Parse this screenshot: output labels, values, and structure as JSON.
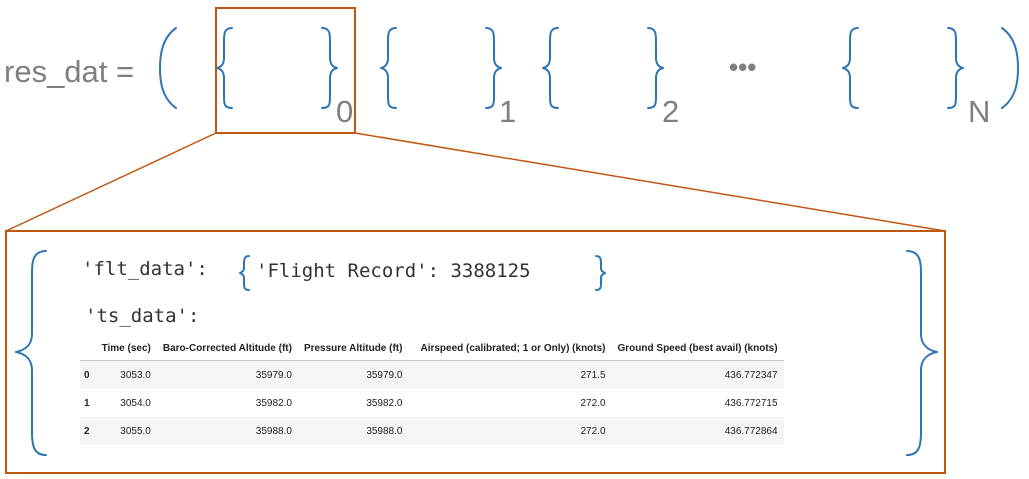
{
  "top": {
    "lhs": "res_dat =",
    "subscripts": [
      "0",
      "1",
      "2",
      "N"
    ],
    "ellipsis": "•••"
  },
  "detail": {
    "flt_key": "'flt_data':",
    "flt_inner": "'Flight Record': 3388125",
    "ts_key": "'ts_data':",
    "table": {
      "headers": [
        "",
        "Time (sec)",
        "Baro-Corrected Altitude (ft)",
        "Pressure Altitude (ft)",
        "Airspeed (calibrated; 1 or Only) (knots)",
        "Ground Speed (best avail) (knots)"
      ],
      "rows": [
        [
          "0",
          "3053.0",
          "35979.0",
          "35979.0",
          "271.5",
          "436.772347"
        ],
        [
          "1",
          "3054.0",
          "35982.0",
          "35982.0",
          "272.0",
          "436.772715"
        ],
        [
          "2",
          "3055.0",
          "35988.0",
          "35988.0",
          "272.0",
          "436.772864"
        ]
      ]
    }
  },
  "colors": {
    "brace": "#2e75b6",
    "highlight": "#c0560f",
    "text": "#7f7f7f"
  }
}
